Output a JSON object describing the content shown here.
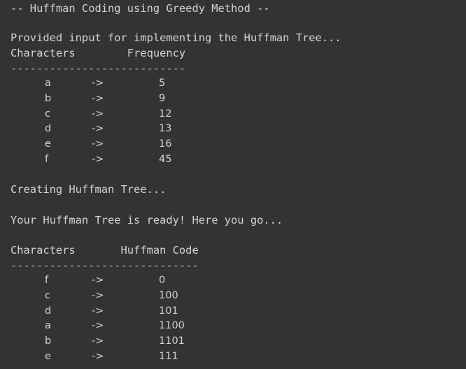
{
  "console": {
    "title": "-- Huffman Coding using Greedy Method --",
    "input_intro": "Provided input for implementing the Huffman Tree...",
    "input_header": "Characters        Frequency",
    "input_divider": "---------------------------",
    "input_rows": [
      {
        "char": "a",
        "arrow": "->",
        "value": "5"
      },
      {
        "char": "b",
        "arrow": "->",
        "value": "9"
      },
      {
        "char": "c",
        "arrow": "->",
        "value": "12"
      },
      {
        "char": "d",
        "arrow": "->",
        "value": "13"
      },
      {
        "char": "e",
        "arrow": "->",
        "value": "16"
      },
      {
        "char": "f",
        "arrow": "->",
        "value": "45"
      }
    ],
    "creating_msg": "Creating Huffman Tree...",
    "ready_msg": "Your Huffman Tree is ready! Here you go...",
    "output_header": "Characters       Huffman Code",
    "output_divider": "-----------------------------",
    "output_rows": [
      {
        "char": "f",
        "arrow": "->",
        "value": "0"
      },
      {
        "char": "c",
        "arrow": "->",
        "value": "100"
      },
      {
        "char": "d",
        "arrow": "->",
        "value": "101"
      },
      {
        "char": "a",
        "arrow": "->",
        "value": "1100"
      },
      {
        "char": "b",
        "arrow": "->",
        "value": "1101"
      },
      {
        "char": "e",
        "arrow": "->",
        "value": "111"
      }
    ]
  },
  "colors": {
    "background": "#333333",
    "text": "#d4d4d4"
  }
}
